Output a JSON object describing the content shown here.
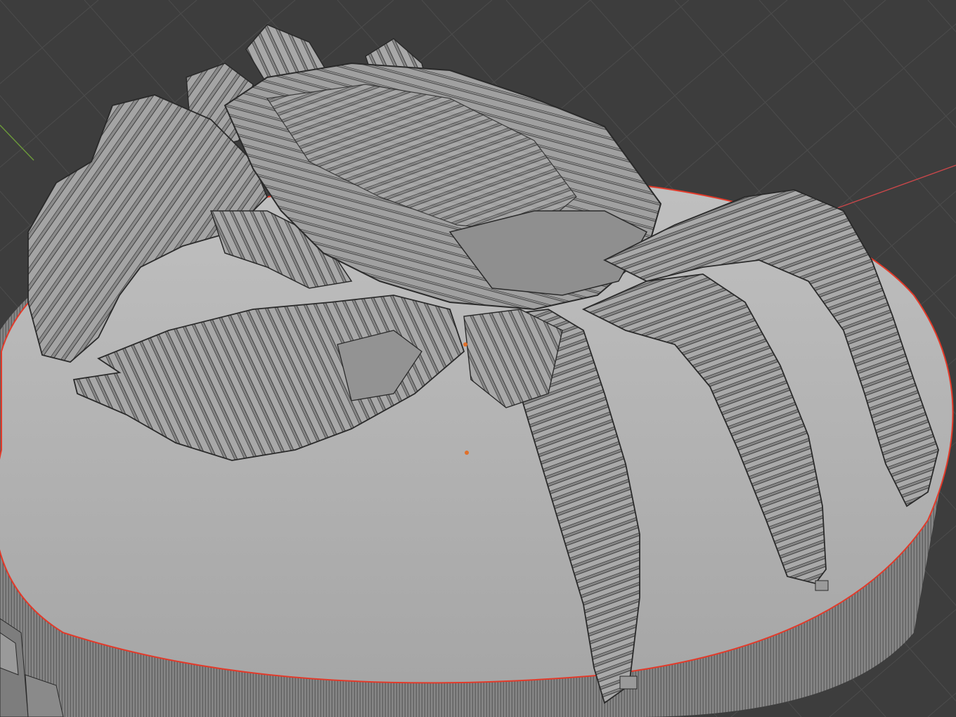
{
  "viewport": {
    "background": "#3d3d3d",
    "grid_line_color": "#4a4a4a",
    "axis_x_color": "#c8474a",
    "axis_y_color": "#6c9a3a"
  },
  "scene": {
    "base_top_color": "#b4b4b4",
    "base_side_color": "#8a8a8a",
    "selection_outline_color": "#e23a2a",
    "model_color": "#a3a3a3",
    "model_shade_color": "#7e7e7e",
    "edge_color": "#2a2a2a",
    "origin_point_color": "#e0702a"
  },
  "icons": {
    "origin": "origin-dot-icon"
  }
}
